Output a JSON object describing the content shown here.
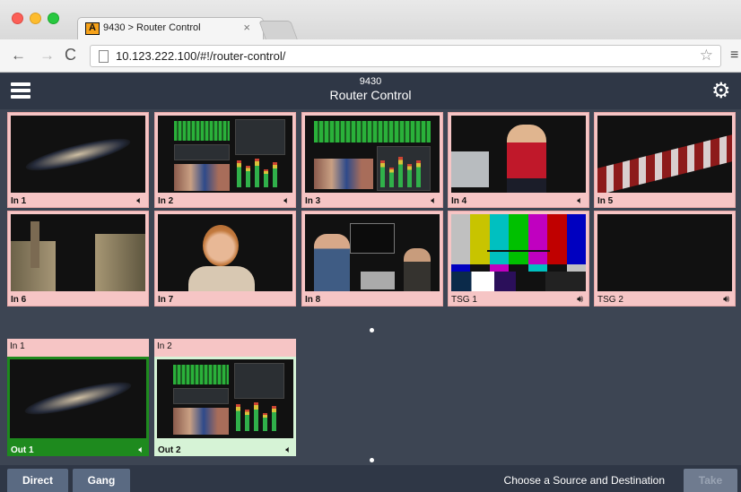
{
  "browser": {
    "tab_title": "9430 > Router Control",
    "tab_close": "×",
    "url": "10.123.222.100/#!/router-control/",
    "back": "←",
    "forward": "→",
    "reload": "C",
    "star": "☆",
    "menu": "≡"
  },
  "app": {
    "device": "9430",
    "title": "Router Control"
  },
  "sources": [
    {
      "label": "In 1",
      "image": "galaxy"
    },
    {
      "label": "In 2",
      "image": "monitor-wall"
    },
    {
      "label": "In 3",
      "image": "monitor-wall-2"
    },
    {
      "label": "In 4",
      "image": "street-girl"
    },
    {
      "label": "In 5",
      "image": "ship-crowd"
    },
    {
      "label": "In 6",
      "image": "city"
    },
    {
      "label": "In 7",
      "image": "woman"
    },
    {
      "label": "In 8",
      "image": "studio"
    },
    {
      "label": "TSG 1",
      "image": "color-bars"
    },
    {
      "label": "TSG 2",
      "image": "black"
    }
  ],
  "destinations": [
    {
      "label": "Out 1",
      "current_source": "In 1",
      "selected": true
    },
    {
      "label": "Out 2",
      "current_source": "In 2",
      "selected": false
    }
  ],
  "bottom": {
    "direct_label": "Direct",
    "gang_label": "Gang",
    "status": "Choose a Source and Destination",
    "take_label": "Take"
  },
  "colors": {
    "source_tile": "#f6c5c5",
    "dest_selected": "#1e8a1e",
    "dest_unselected": "#d6f3d6",
    "header_bg": "#2f3746"
  }
}
